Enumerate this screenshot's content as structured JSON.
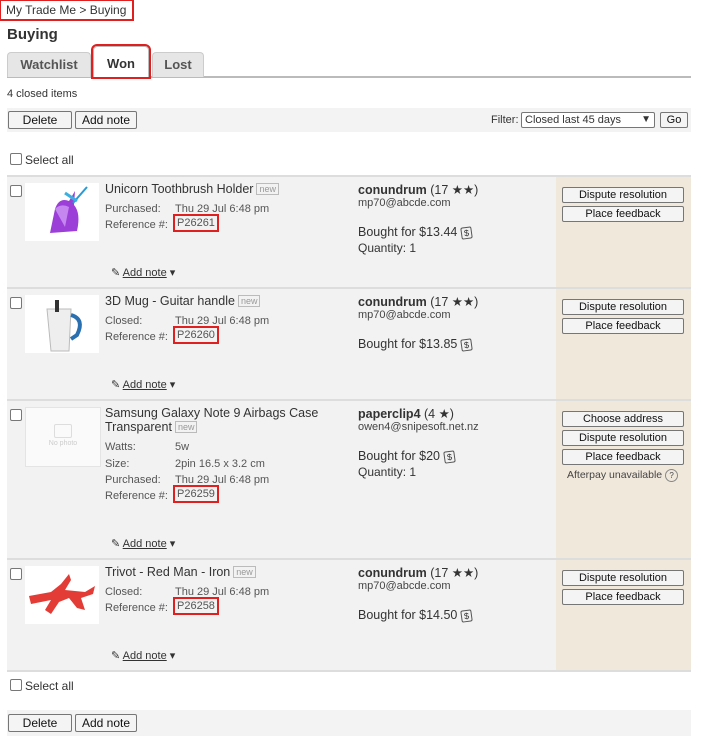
{
  "breadcrumb": "My Trade Me > Buying",
  "page_title": "Buying",
  "tabs": [
    "Watchlist",
    "Won",
    "Lost"
  ],
  "closed_count": "4 closed items",
  "toolbar": {
    "delete": "Delete",
    "add_note": "Add note",
    "filter_label": "Filter:",
    "filter_value": "Closed last 45 days",
    "go": "Go"
  },
  "select_all": "Select all",
  "items": [
    {
      "title": "Unicorn Toothbrush Holder",
      "tag": "new",
      "details": [
        [
          "Purchased:",
          "Thu 29 Jul 6:48 pm"
        ],
        [
          "Reference #:",
          "P26261"
        ]
      ],
      "seller": "conundrum",
      "rating": "(17 ★★)",
      "email": "mp70@abcde.com",
      "bought": "Bought for $13.44",
      "quantity": "Quantity: 1",
      "actions": [
        "Dispute resolution",
        "Place feedback"
      ],
      "add_note": "Add note"
    },
    {
      "title": "3D Mug - Guitar handle",
      "tag": "new",
      "details": [
        [
          "Closed:",
          "Thu 29 Jul 6:48 pm"
        ],
        [
          "Reference #:",
          "P26260"
        ]
      ],
      "seller": "conundrum",
      "rating": "(17 ★★)",
      "email": "mp70@abcde.com",
      "bought": "Bought for $13.85",
      "quantity": "",
      "actions": [
        "Dispute resolution",
        "Place feedback"
      ],
      "add_note": "Add note"
    },
    {
      "title": "Samsung Galaxy Note 9 Airbags Case Transparent",
      "tag": "new",
      "details": [
        [
          "Watts:",
          "5w"
        ],
        [
          "Size:",
          "2pin 16.5 x 3.2 cm"
        ],
        [
          "Purchased:",
          "Thu 29 Jul 6:48 pm"
        ],
        [
          "Reference #:",
          "P26259"
        ]
      ],
      "seller": "paperclip4",
      "rating": "(4 ★)",
      "email": "owen4@snipesoft.net.nz",
      "bought": "Bought for $20",
      "quantity": "Quantity: 1",
      "actions": [
        "Choose address",
        "Dispute resolution",
        "Place feedback"
      ],
      "afterpay": "Afterpay unavailable",
      "no_photo": "No photo",
      "add_note": "Add note"
    },
    {
      "title": "Trivot - Red Man - Iron",
      "tag": "new",
      "details": [
        [
          "Closed:",
          "Thu 29 Jul 6:48 pm"
        ],
        [
          "Reference #:",
          "P26258"
        ]
      ],
      "seller": "conundrum",
      "rating": "(17 ★★)",
      "email": "mp70@abcde.com",
      "bought": "Bought for $14.50",
      "quantity": "",
      "actions": [
        "Dispute resolution",
        "Place feedback"
      ],
      "add_note": "Add note"
    }
  ],
  "price_tag_icon": "$",
  "colors": {
    "highlight": "#e02020",
    "action_column": "#f1e8dc"
  }
}
